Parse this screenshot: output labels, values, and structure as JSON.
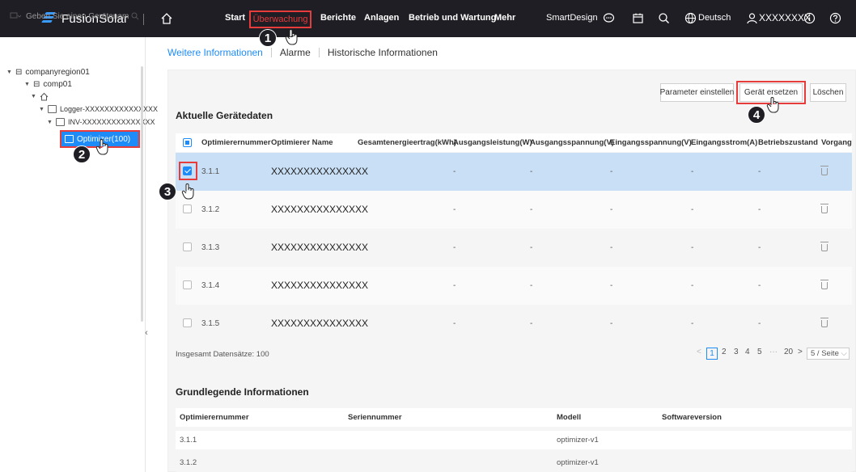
{
  "topbar": {
    "brand": "FusionSolar",
    "nav": [
      "Start",
      "Überwachung",
      "Berichte",
      "Anlagen",
      "Betrieb und Wartung",
      "Mehr"
    ],
    "smart_design": "SmartDesign",
    "language": "Deutsch",
    "user": "XXXXXXXX"
  },
  "sidebar": {
    "search_select": "⌵",
    "search_placeholder": "Geben Sie einen Gerätenam",
    "tree": {
      "region": "companyregion01",
      "company": "comp01",
      "logger": "Logger-XXXXXXXXXXXXXXX",
      "inverter": "INV-XXXXXXXXXXXXXXX",
      "optimizer": "Optimizer(100)"
    }
  },
  "tabs": [
    "Weitere Informationen",
    "Alarme",
    "Historische Informationen"
  ],
  "buttons": {
    "set_params": "Parameter einstellen",
    "replace_device": "Gerät ersetzen",
    "delete": "Löschen"
  },
  "current_data": {
    "title": "Aktuelle Gerätedaten",
    "headers": [
      "Optimierernummer",
      "Optimierer Name",
      "Gesamtenergieertrag(kWh)",
      "Ausgangsleistung(W)",
      "Ausgangsspannung(V)",
      "Eingangsspannung(V)",
      "Eingangsstrom(A)",
      "Betriebszustand",
      "Vorgang"
    ],
    "rows": [
      {
        "num": "3.1.1",
        "name": "XXXXXXXXXXXXXXX",
        "v1": "-",
        "v2": "-",
        "v3": "-",
        "v4": "-",
        "v5": "-",
        "v6": "-",
        "checked": true
      },
      {
        "num": "3.1.2",
        "name": "XXXXXXXXXXXXXXX",
        "v1": "-",
        "v2": "-",
        "v3": "-",
        "v4": "-",
        "v5": "-",
        "v6": "-",
        "checked": false
      },
      {
        "num": "3.1.3",
        "name": "XXXXXXXXXXXXXXX",
        "v1": "-",
        "v2": "-",
        "v3": "-",
        "v4": "-",
        "v5": "-",
        "v6": "-",
        "checked": false
      },
      {
        "num": "3.1.4",
        "name": "XXXXXXXXXXXXXXX",
        "v1": "-",
        "v2": "-",
        "v3": "-",
        "v4": "-",
        "v5": "-",
        "v6": "-",
        "checked": false
      },
      {
        "num": "3.1.5",
        "name": "XXXXXXXXXXXXXXX",
        "v1": "-",
        "v2": "-",
        "v3": "-",
        "v4": "-",
        "v5": "-",
        "v6": "-",
        "checked": false
      }
    ],
    "total": "Insgesamt Datensätze: 100"
  },
  "pagination": {
    "prev": "<",
    "current": "1",
    "pages": [
      "2",
      "3",
      "4",
      "5"
    ],
    "ellipsis": "···",
    "last": "20",
    "next": ">",
    "page_size": "5 / Seite"
  },
  "basic_info": {
    "title": "Grundlegende Informationen",
    "headers": [
      "Optimierernummer",
      "Seriennummer",
      "Modell",
      "Softwareversion"
    ],
    "rows": [
      {
        "num": "3.1.1",
        "serial": "",
        "model": "optimizer-v1",
        "sw": ""
      },
      {
        "num": "3.1.2",
        "serial": "",
        "model": "optimizer-v1",
        "sw": ""
      }
    ]
  },
  "steps": [
    "1",
    "2",
    "3",
    "4"
  ],
  "colors": {
    "accent": "#1d8cf8",
    "highlight": "#e63c3c",
    "topbar": "#1e1e24",
    "selected_row": "#c9dff5"
  }
}
